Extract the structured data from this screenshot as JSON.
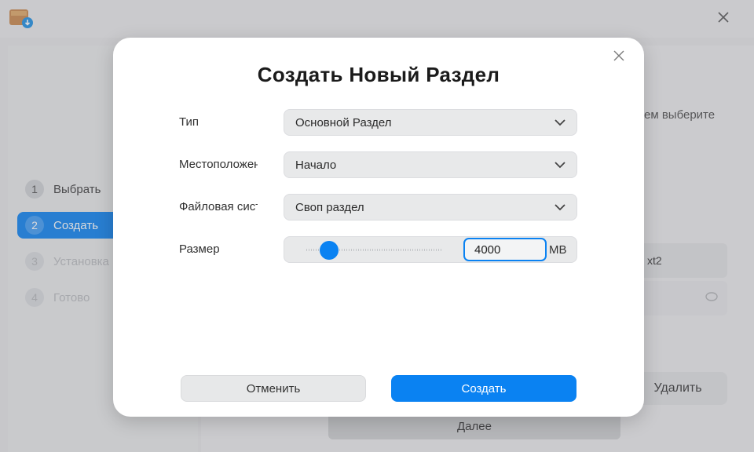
{
  "window": {
    "close_icon": "close-icon",
    "app_icon": "installer-icon"
  },
  "sidebar": {
    "steps": [
      {
        "number": "1",
        "label": "Выбрать",
        "state": "done"
      },
      {
        "number": "2",
        "label": "Создать",
        "state": "active"
      },
      {
        "number": "3",
        "label": "Установка",
        "state": "pending"
      },
      {
        "number": "4",
        "label": "Готово",
        "state": "pending"
      }
    ]
  },
  "background": {
    "hint_text": "ем выберите",
    "partition_label": "xt2",
    "delete_label": "Удалить",
    "next_label": "Далее"
  },
  "dialog": {
    "title": "Создать Новый Раздел",
    "fields": {
      "type": {
        "label": "Тип",
        "value": "Основной Раздел"
      },
      "location": {
        "label": "Местоположение",
        "value": "Начало"
      },
      "filesystem": {
        "label": "Файловая система",
        "value": "Своп раздел"
      },
      "size": {
        "label": "Размер",
        "value": "4000",
        "unit": "MB",
        "slider_fraction": 0.1
      }
    },
    "cancel_label": "Отменить",
    "create_label": "Создать"
  },
  "colors": {
    "accent": "#0a82f2",
    "dialog_bg": "#ffffff",
    "field_bg": "#e8e9ea"
  }
}
